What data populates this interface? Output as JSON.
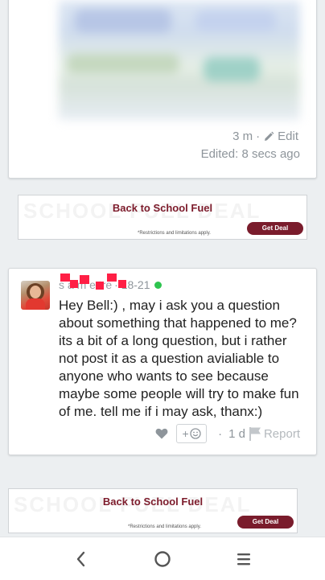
{
  "post": {
    "time": "3 m",
    "separator": "·",
    "edit_label": "Edit",
    "edited_text": "Edited: 8 secs ago"
  },
  "ads": [
    {
      "title": "Back to School Fuel",
      "fine_print": "*Restrictions and limitations apply.",
      "button_label": "Get Deal",
      "watermark": "SCHOOL FUEL DEAL"
    },
    {
      "title": "Back to School Fuel",
      "fine_print": "*Restrictions and limitations apply.",
      "button_label": "Get Deal",
      "watermark": "SCHOOL FUEL DEAL"
    }
  ],
  "comment": {
    "author_partial": "s  a  m  e  tre",
    "date": "· 18-21",
    "online_color": "#2ec44f",
    "text": "Hey Bell:) , may i ask you a question about something that happened to me? its a bit of a long question, but i rather not post it as a question avialiable to anyone who wants to see because maybe some people will try to make fun of me. tell me if i may ask, thanx:)",
    "react_label": "+",
    "dot": "·",
    "age": "1 d",
    "report_label": "Report"
  },
  "navigation": {
    "back_icon": "back-chevron-icon",
    "home_icon": "home-circle-icon",
    "recents_icon": "recents-lines-icon"
  },
  "colors": {
    "ad_accent": "#7a1c2c",
    "redaction": "#ff1f45"
  }
}
